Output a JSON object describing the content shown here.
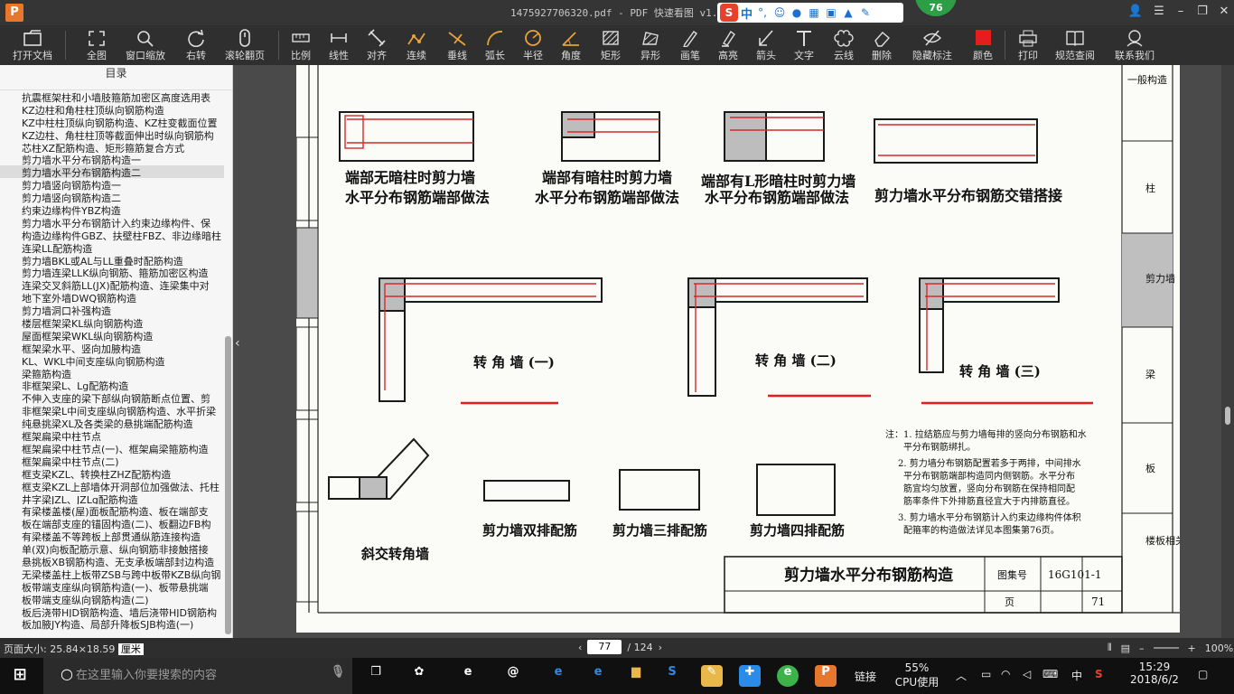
{
  "window": {
    "title": "1475927706320.pdf - PDF 快速看图 v1.9"
  },
  "ime": {
    "lang": "中"
  },
  "badge": {
    "value": "76"
  },
  "toolbar": {
    "items": [
      "打开文档",
      "全图",
      "窗口缩放",
      "右转",
      "滚轮翻页",
      "比例",
      "线性",
      "对齐",
      "连续",
      "垂线",
      "弧长",
      "半径",
      "角度",
      "矩形",
      "异形",
      "画笔",
      "高亮",
      "箭头",
      "文字",
      "云线",
      "删除",
      "隐藏标注",
      "颜色",
      "打印",
      "规范查阅",
      "联系我们"
    ]
  },
  "sidebar": {
    "title": "目录",
    "items": [
      "抗震框架柱和小墙肢箍筋加密区高度选用表",
      "KZ边柱和角柱柱顶纵向钢筋构造",
      "KZ中柱柱顶纵向钢筋构造、KZ柱变截面位置",
      "KZ边柱、角柱柱顶等截面伸出时纵向钢筋构",
      "芯柱XZ配筋构造、矩形箍筋复合方式",
      "剪力墙水平分布钢筋构造一",
      "剪力墙水平分布钢筋构造二",
      "剪力墙竖向钢筋构造一",
      "剪力墙竖向钢筋构造二",
      "约束边缘构件YBZ构造",
      "剪力墙水平分布钢筋计入约束边缘构件、保",
      "构造边缘构件GBZ、扶壁柱FBZ、非边缘暗柱",
      "连梁LL配筋构造",
      "剪力墙BKL或AL与LL重叠时配筋构造",
      "剪力墙连梁LLK纵向钢筋、箍筋加密区构造",
      "连梁交叉斜筋LL(JX)配筋构造、连梁集中对",
      "地下室外墙DWQ钢筋构造",
      "剪力墙洞口补强构造",
      "楼层框架梁KL纵向钢筋构造",
      "屋面框架梁WKL纵向钢筋构造",
      "框架梁水平、竖向加腋构造",
      "KL、WKL中间支座纵向钢筋构造",
      "梁箍筋构造",
      "非框架梁L、Lg配筋构造",
      "不伸入支座的梁下部纵向钢筋断点位置、剪",
      "非框架梁L中间支座纵向钢筋构造、水平折梁",
      "纯悬挑梁XL及各类梁的悬挑端配筋构造",
      "框架扁梁中柱节点",
      "框架扁梁中柱节点(一)、框架扁梁箍筋构造",
      "框架扁梁中柱节点(二)",
      "框支梁KZL、转换柱ZHZ配筋构造",
      "框支梁KZL上部墙体开洞部位加强做法、托柱",
      "井字梁JZL、JZLg配筋构造",
      "有梁楼盖楼(屋)面板配筋构造、板在端部支",
      "板在端部支座的锚固构造(二)、板翻边FB构",
      "有梁楼盖不等跨板上部贯通纵筋连接构造",
      "单(双)向板配筋示意、纵向钢筋非接触搭接",
      "悬挑板XB钢筋构造、无支承板端部封边构造",
      "无梁楼盖柱上板带ZSB与跨中板带KZB纵向钢",
      "板带端支座纵向钢筋构造(一)、板带悬挑端",
      "板带端支座纵向钢筋构造(二)",
      "板后浇带HJD钢筋构造、墙后浇带HJD钢筋构",
      "板加腋JY构造、局部升降板SJB构造(一)"
    ],
    "selected_index": 6
  },
  "status": {
    "page_size_label": "页面大小: 25.84×18.59 ",
    "unit": "厘米",
    "current_page": "77",
    "total_pages": "/ 124",
    "zoom": "100%"
  },
  "taskbar": {
    "search_placeholder": "在这里输入你要搜索的内容",
    "link_label": "链接",
    "cpu_pct": "55%",
    "cpu_label": "CPU使用",
    "lang": "中",
    "time": "15:29",
    "date": "2018/6/2"
  },
  "colors": {
    "accent_orange": "#e8772e",
    "markup_red": "#e41e1e",
    "badge_green": "#2d9e45"
  }
}
